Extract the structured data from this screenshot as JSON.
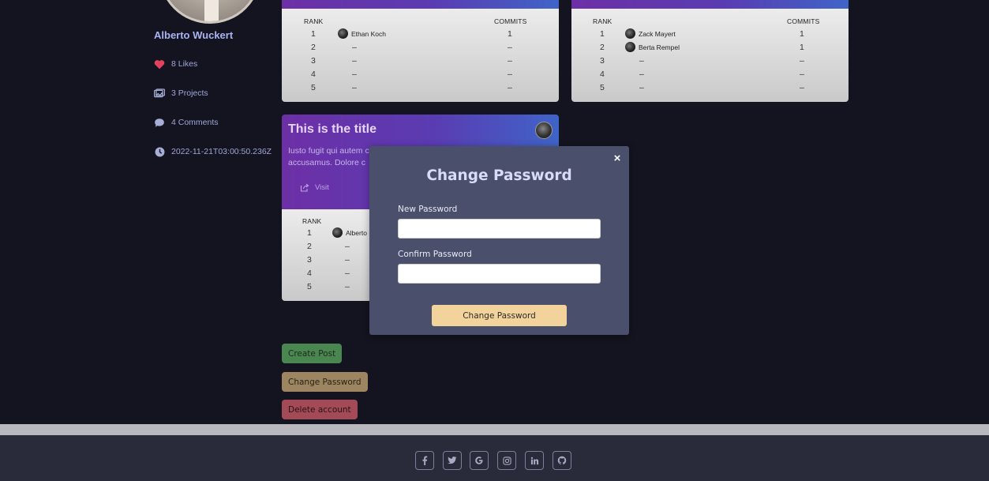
{
  "profile": {
    "name": "Alberto Wuckert",
    "likes": "8 Likes",
    "projects": "3 Projects",
    "comments": "4 Comments",
    "date": "2022-11-21T03:00:50.236Z"
  },
  "leaderboards": [
    {
      "rank_header": "RANK",
      "commits_header": "COMMITS",
      "rows": [
        {
          "rank": "1",
          "name": "Ethan Koch",
          "commits": "1"
        },
        {
          "rank": "2",
          "name": "–",
          "commits": "–"
        },
        {
          "rank": "3",
          "name": "–",
          "commits": "–"
        },
        {
          "rank": "4",
          "name": "–",
          "commits": "–"
        },
        {
          "rank": "5",
          "name": "–",
          "commits": "–"
        }
      ]
    },
    {
      "rank_header": "RANK",
      "commits_header": "COMMITS",
      "rows": [
        {
          "rank": "1",
          "name": "Zack Mayert",
          "commits": "1"
        },
        {
          "rank": "2",
          "name": "Berta Rempel",
          "commits": "1"
        },
        {
          "rank": "3",
          "name": "–",
          "commits": "–"
        },
        {
          "rank": "4",
          "name": "–",
          "commits": "–"
        },
        {
          "rank": "5",
          "name": "–",
          "commits": "–"
        }
      ]
    }
  ],
  "post": {
    "title": "This is the title",
    "desc_line1": "Iusto fugit qui autem c",
    "desc_line2": "accusamus. Dolore c",
    "visit": "Visit",
    "rank_header": "RANK",
    "rows": [
      {
        "rank": "1",
        "name": "Alberto"
      },
      {
        "rank": "2",
        "name": "–"
      },
      {
        "rank": "3",
        "name": "–"
      },
      {
        "rank": "4",
        "name": "–"
      },
      {
        "rank": "5",
        "name": "–"
      }
    ]
  },
  "actions": {
    "create_post": "Create Post",
    "change_password": "Change Password",
    "delete_account": "Delete account"
  },
  "modal": {
    "close": "×",
    "title": "Change Password",
    "new_password_label": "New Password",
    "confirm_password_label": "Confirm Password",
    "submit": "Change Password"
  },
  "footer": {
    "icons": [
      "facebook-icon",
      "twitter-icon",
      "google-icon",
      "instagram-icon",
      "linkedin-icon",
      "github-icon"
    ]
  }
}
